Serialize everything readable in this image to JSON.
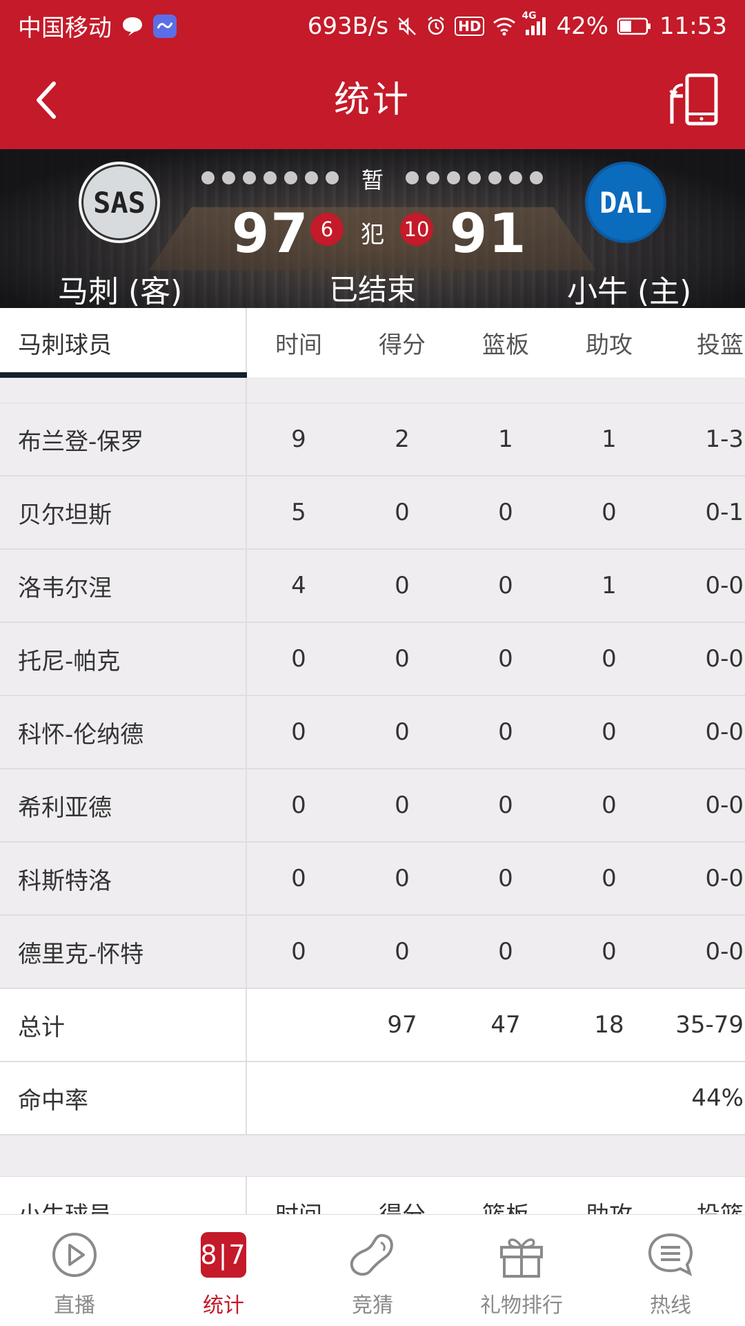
{
  "status_bar": {
    "carrier": "中国移动",
    "net_speed": "693B/s",
    "hd_badge": "HD",
    "network_type": "4G",
    "battery": "42%",
    "time": "11:53"
  },
  "header": {
    "title": "统计"
  },
  "scoreboard": {
    "timeout_label": "暂",
    "away": {
      "abbr": "SAS",
      "name": "马刺 (客)",
      "score": "97",
      "fouls": "6",
      "logo_color": "#d8dbde"
    },
    "home": {
      "abbr": "DAL",
      "name": "小牛 (主)",
      "score": "91",
      "fouls": "10",
      "logo_color": "#0b6bbd"
    },
    "foul_label": "犯",
    "game_status": "已结束"
  },
  "spurs_table": {
    "tab_label": "马刺球员",
    "columns": [
      "时间",
      "得分",
      "篮板",
      "助攻",
      "投篮"
    ],
    "players": [
      {
        "name": "布兰登-保罗",
        "stats": [
          "9",
          "2",
          "1",
          "1",
          "1-3"
        ]
      },
      {
        "name": "贝尔坦斯",
        "stats": [
          "5",
          "0",
          "0",
          "0",
          "0-1"
        ]
      },
      {
        "name": "洛韦尔涅",
        "stats": [
          "4",
          "0",
          "0",
          "1",
          "0-0"
        ]
      },
      {
        "name": "托尼-帕克",
        "stats": [
          "0",
          "0",
          "0",
          "0",
          "0-0"
        ]
      },
      {
        "name": "科怀-伦纳德",
        "stats": [
          "0",
          "0",
          "0",
          "0",
          "0-0"
        ]
      },
      {
        "name": "希利亚德",
        "stats": [
          "0",
          "0",
          "0",
          "0",
          "0-0"
        ]
      },
      {
        "name": "科斯特洛",
        "stats": [
          "0",
          "0",
          "0",
          "0",
          "0-0"
        ]
      },
      {
        "name": "德里克-怀特",
        "stats": [
          "0",
          "0",
          "0",
          "0",
          "0-0"
        ]
      }
    ],
    "total": {
      "label": "总计",
      "stats": [
        "",
        "97",
        "47",
        "18",
        "35-79"
      ]
    },
    "pct": {
      "label": "命中率",
      "stats": [
        "",
        "",
        "",
        "",
        "44%"
      ]
    }
  },
  "mavs_table": {
    "tab_label": "小牛球员",
    "columns": [
      "时间",
      "得分",
      "篮板",
      "助攻",
      "投篮"
    ]
  },
  "bottom_nav": [
    {
      "label": "直播",
      "icon": "play-icon",
      "active": false
    },
    {
      "label": "统计",
      "icon": "stats-icon",
      "active": true,
      "icon_text": "8|7"
    },
    {
      "label": "竞猜",
      "icon": "bean-icon",
      "active": false
    },
    {
      "label": "礼物排行",
      "icon": "gift-icon",
      "active": false
    },
    {
      "label": "热线",
      "icon": "chat-icon",
      "active": false
    }
  ],
  "colors": {
    "brand_red": "#c41a29",
    "tab_underline": "#15202a"
  }
}
